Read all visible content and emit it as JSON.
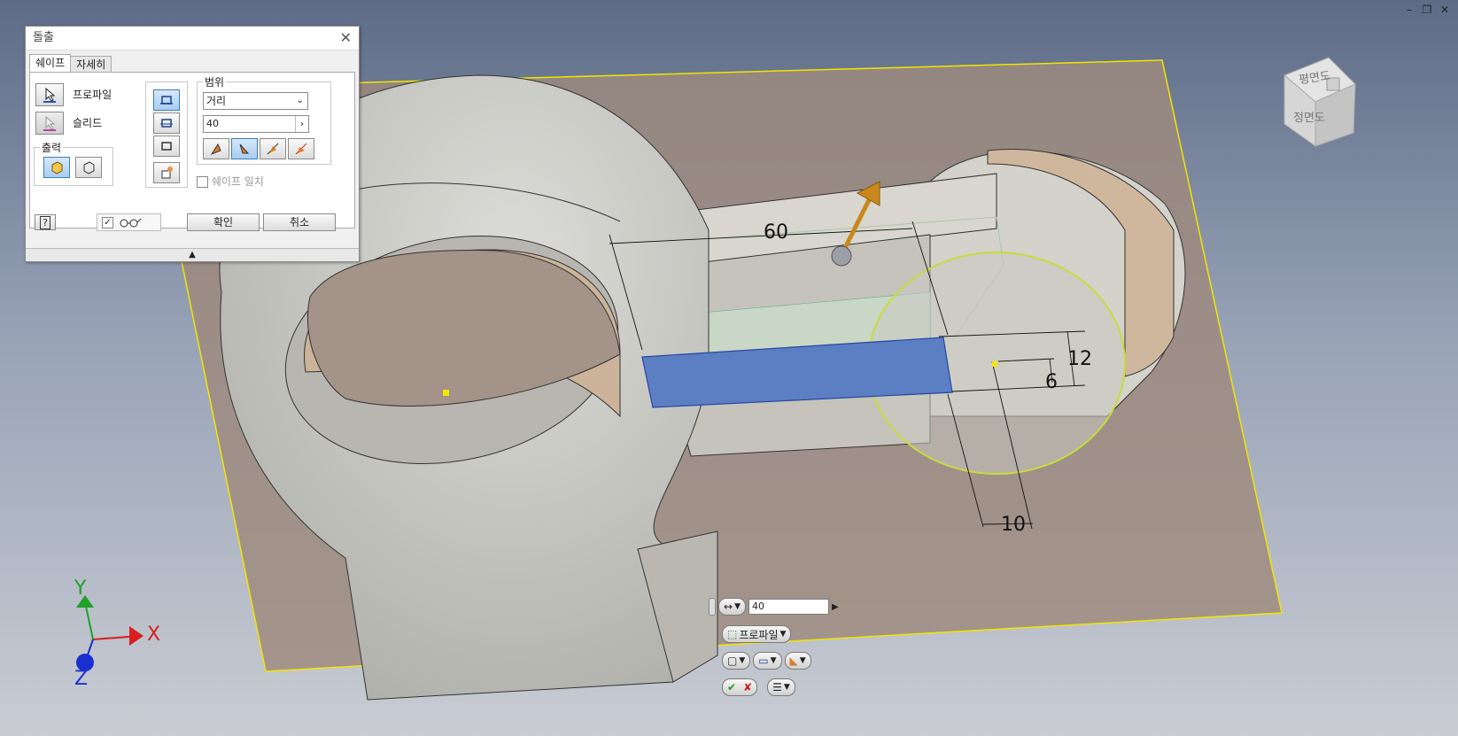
{
  "window": {
    "minimize_glyph": "–",
    "restore_glyph": "❐",
    "close_glyph": "✕"
  },
  "dialog": {
    "title": "돌출",
    "close_glyph": "✕",
    "tabs": [
      {
        "label": "쉐이프"
      },
      {
        "label": "자세히"
      }
    ],
    "profile_label": "프로파일",
    "solid_label": "슬리드",
    "output_group_label": "출력",
    "extents_group_label": "범위",
    "extent_type": "거리",
    "distance_value": "40",
    "match_shape_label": "쉐이프 일치",
    "ok_label": "확인",
    "cancel_label": "취소",
    "help_glyph": "?",
    "collapse_glyph": "▲"
  },
  "mini_toolbar": {
    "distance_value": "40",
    "profile_label": "프로파일"
  },
  "dimensions": {
    "length": "60",
    "height": "12",
    "offset": "6",
    "depth": "10"
  },
  "view_cube": {
    "top_face_label": "평면도",
    "front_face_label": "정면도"
  },
  "axes": {
    "x_label": "X",
    "y_label": "Y",
    "z_label": "Z"
  },
  "colors": {
    "selected_profile": "#5b7fc2",
    "sketch_plane_border": "#f2e600",
    "axis_x": "#d81e1e",
    "axis_y": "#1fa02a",
    "axis_z": "#1a2fd0",
    "direction_arrow": "#c8881c"
  }
}
